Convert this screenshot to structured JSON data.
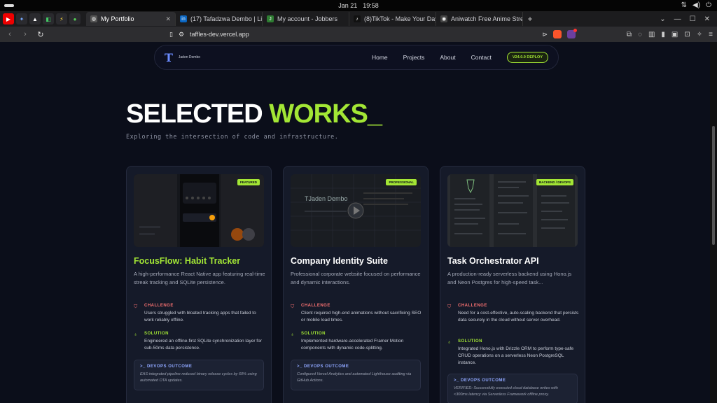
{
  "os": {
    "date": "Jan 21",
    "time": "19:58"
  },
  "tabs": [
    {
      "title": "My Portfolio",
      "active": true,
      "fav_color": "#555"
    },
    {
      "title": "(17) Tafadzwa Dembo | Link",
      "fav_color": "#0a66c2",
      "fav": "in"
    },
    {
      "title": "My account - Jobbers",
      "fav_color": "#2e7d32",
      "fav": "J"
    },
    {
      "title": "(8)TikTok - Make Your Day",
      "fav_color": "#111",
      "fav": "♪"
    },
    {
      "title": "Aniwatch Free Anime Strea",
      "fav_color": "#444",
      "fav": "◉"
    }
  ],
  "address": {
    "url": "taffles-dev.vercel.app"
  },
  "site": {
    "logo_letter": "T",
    "logo_name": "Jaden Dembo",
    "nav": [
      "Home",
      "Projects",
      "About",
      "Contact"
    ],
    "deploy": "V24.0.0 DEPLOY"
  },
  "hero": {
    "title_white": "SELECTED ",
    "title_green": "WORKS_",
    "subtitle": "Exploring the intersection of code and infrastructure."
  },
  "projects": [
    {
      "badge": "FEATURED",
      "title": "FocusFlow: Habit Tracker",
      "desc": "A high-performance React Native app featuring real-time streak tracking and SQLite persistence.",
      "challenge_label": "CHALLENGE",
      "challenge": "Users struggled with bloated tracking apps that failed to work reliably offline.",
      "solution_label": "SOLUTION",
      "solution": "Engineered an offline-first SQLite synchronization layer for sub-50ms data persistence.",
      "devops_label": "DEVOPS OUTCOME",
      "devops": "EAS-integrated pipeline reduced binary release cycles by 60% using automated OTA updates."
    },
    {
      "badge": "PROFESSIONAL",
      "thumb_name": "Jaden Dembo",
      "title": "Company Identity Suite",
      "desc": "Professional corporate website focused on performance and dynamic interactions.",
      "challenge_label": "CHALLENGE",
      "challenge": "Client required high-end animations without sacrificing SEO or mobile load times.",
      "solution_label": "SOLUTION",
      "solution": "Implemented hardware-accelerated Framer Motion components with dynamic code-splitting.",
      "devops_label": "DEVOPS OUTCOME",
      "devops": "Configured Vercel Analytics and automated Lighthouse auditing via GitHub Actions."
    },
    {
      "badge": "BACKEND / DEVOPS",
      "title": "Task Orchestrator API",
      "desc": "A production-ready serverless backend using Hono.js and Neon Postgres for high-speed task...",
      "challenge_label": "CHALLENGE",
      "challenge": "Need for a cost-effective, auto-scaling backend that persists data securely in the cloud without server overhead.",
      "solution_label": "SOLUTION",
      "solution": "Integrated Hono.js with Drizzle ORM to perform type-safe CRUD operations on a serverless Neon PostgreSQL instance.",
      "devops_label": "DEVOPS OUTCOME",
      "devops": "VERIFIED: Successfully executed cloud database writes with <300ms latency via Serverless Framework offline proxy."
    }
  ]
}
